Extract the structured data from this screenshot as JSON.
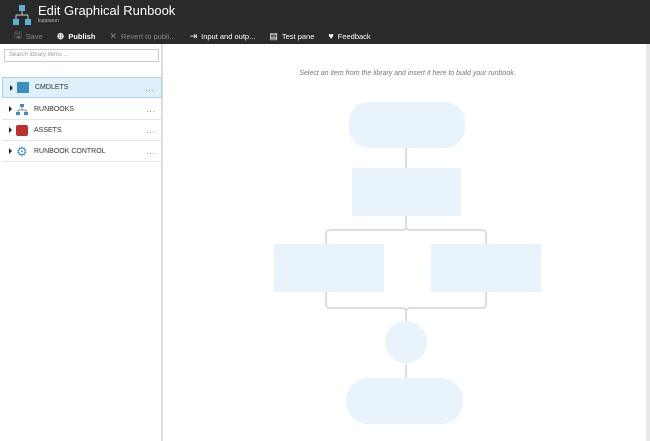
{
  "header": {
    "title": "Edit Graphical Runbook",
    "subtitle": "kupparun"
  },
  "toolbar": [
    {
      "label": "Save",
      "icon": "save-icon",
      "disabled": true,
      "glyph": "🖫"
    },
    {
      "label": "Publish",
      "icon": "globe-icon",
      "disabled": false,
      "glyph": "⊕"
    },
    {
      "label": "Revert to publi...",
      "icon": "close-icon",
      "disabled": true,
      "glyph": "✕"
    },
    {
      "label": "Input and outp...",
      "icon": "input-output-icon",
      "disabled": false,
      "glyph": "⇥"
    },
    {
      "label": "Test pane",
      "icon": "test-pane-icon",
      "disabled": false,
      "glyph": "▤"
    },
    {
      "label": "Feedback",
      "icon": "heart-icon",
      "disabled": false,
      "glyph": "♥"
    }
  ],
  "library": {
    "search_placeholder": "Search library items ...",
    "items": [
      {
        "label": "CMDLETS",
        "more": "..."
      },
      {
        "label": "RUNBOOKS",
        "more": "..."
      },
      {
        "label": "ASSETS",
        "more": "..."
      },
      {
        "label": "RUNBOOK CONTROL",
        "more": "..."
      }
    ]
  },
  "canvas": {
    "hint": "Select an item from the library and insert it here to build your runbook."
  }
}
